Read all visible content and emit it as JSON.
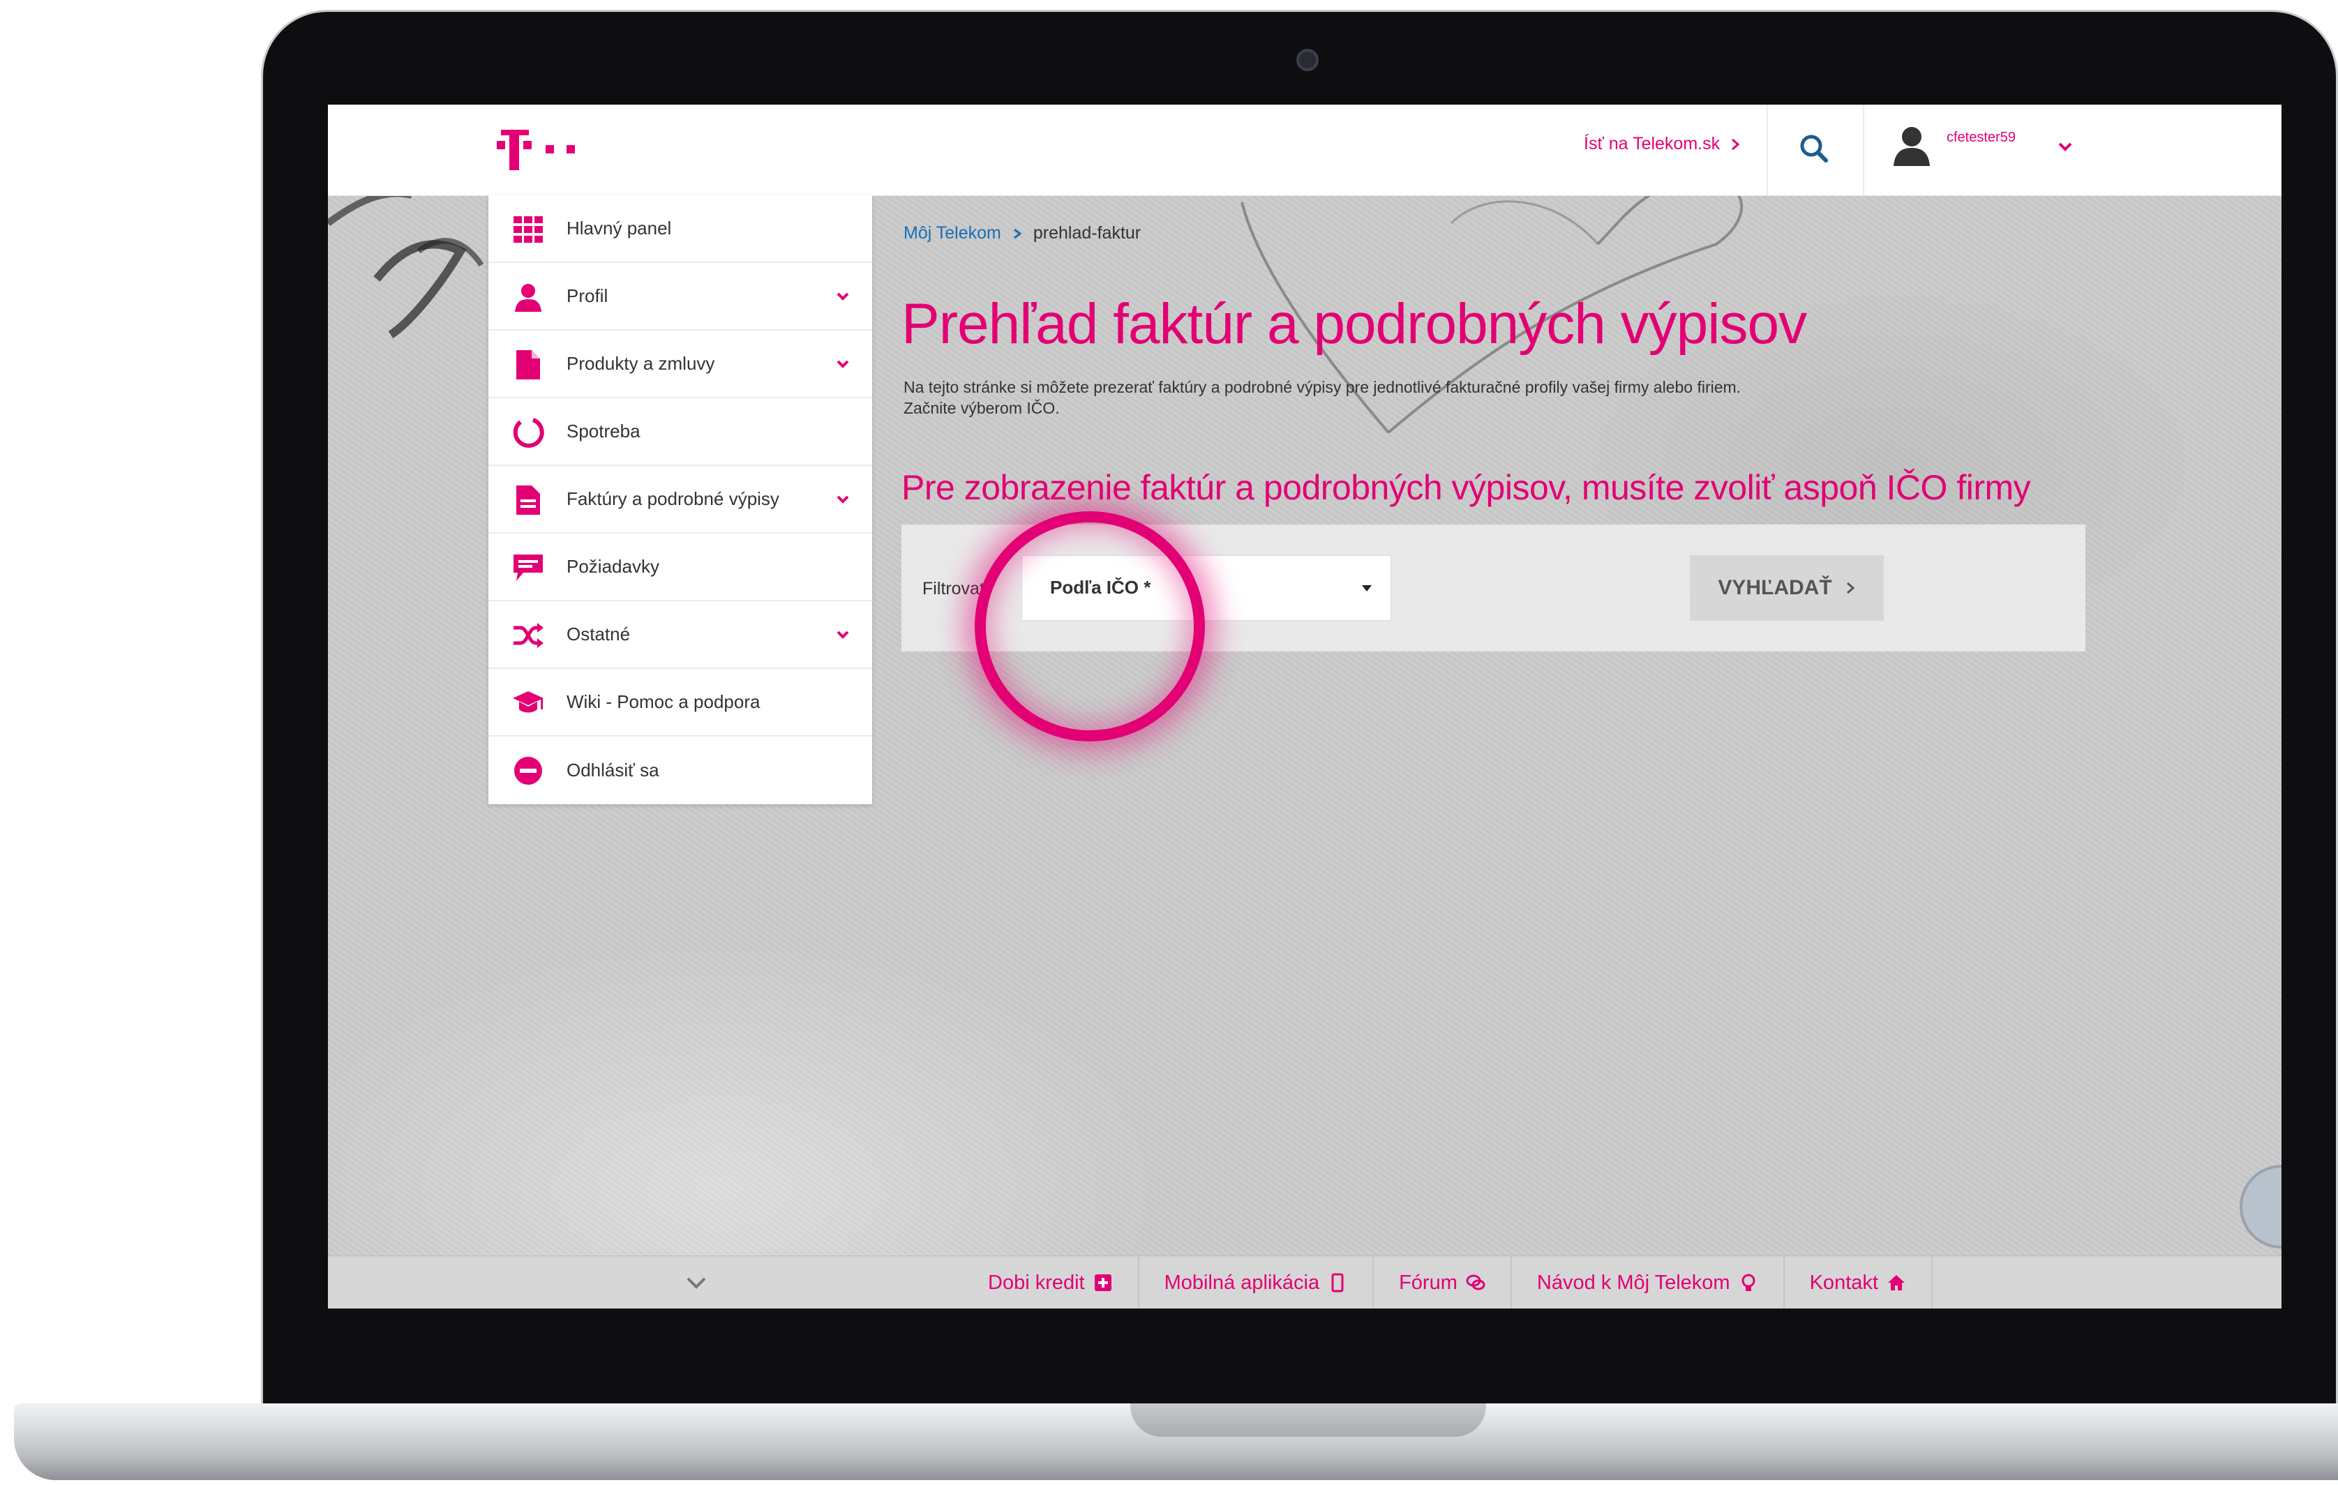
{
  "header": {
    "goto_link": "Ísť na Telekom.sk",
    "username": "cfetester59"
  },
  "sidebar": {
    "items": [
      {
        "label": "Hlavný panel",
        "icon": "grid-icon",
        "has_submenu": false
      },
      {
        "label": "Profil",
        "icon": "user-icon",
        "has_submenu": true
      },
      {
        "label": "Produkty a zmluvy",
        "icon": "document-icon",
        "has_submenu": true
      },
      {
        "label": "Spotreba",
        "icon": "circle-icon",
        "has_submenu": false
      },
      {
        "label": "Faktúry a podrobné výpisy",
        "icon": "invoice-icon",
        "has_submenu": true
      },
      {
        "label": "Požiadavky",
        "icon": "chat-icon",
        "has_submenu": false
      },
      {
        "label": "Ostatné",
        "icon": "shuffle-icon",
        "has_submenu": true
      },
      {
        "label": "Wiki - Pomoc a podpora",
        "icon": "graduation-cap-icon",
        "has_submenu": false
      },
      {
        "label": "Odhlásiť sa",
        "icon": "minus-circle-icon",
        "has_submenu": false
      }
    ]
  },
  "breadcrumb": {
    "root": "Môj Telekom",
    "current": "prehlad-faktur"
  },
  "main": {
    "title": "Prehľad faktúr a podrobných výpisov",
    "description_line1": "Na tejto stránke si môžete prezerať faktúry a podrobné výpisy pre jednotlivé fakturačné profily vašej firmy alebo firiem.",
    "description_line2": "Začnite výberom IČO.",
    "warning": "Pre zobrazenie faktúr a podrobných výpisov, musíte zvoliť aspoň IČO firmy"
  },
  "filter": {
    "label": "Filtrovať",
    "select_value": "Podľa IČO *",
    "button_label": "VYHĽADAŤ"
  },
  "footer": {
    "links": [
      {
        "label": "Dobi kredit",
        "icon": "plus-square-icon"
      },
      {
        "label": "Mobilná aplikácia",
        "icon": "mobile-icon"
      },
      {
        "label": "Fórum",
        "icon": "comments-icon"
      },
      {
        "label": "Návod k Môj Telekom",
        "icon": "lightbulb-icon"
      },
      {
        "label": "Kontakt",
        "icon": "home-icon"
      }
    ]
  },
  "colors": {
    "brand_magenta": "#e20074",
    "link_blue": "#1a6fb3"
  }
}
